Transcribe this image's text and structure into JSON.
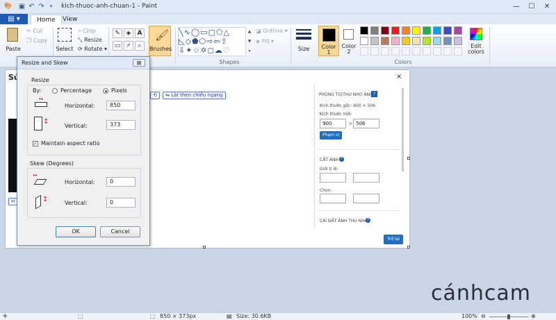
{
  "window": {
    "title": "kich-thuoc-anh-chuan-1 - Paint"
  },
  "tabs": {
    "file": "▤ ▾",
    "home": "Home",
    "view": "View"
  },
  "ribbon": {
    "clipboard": {
      "paste": "Paste",
      "cut": "Cut",
      "copy": "Copy",
      "label": "C"
    },
    "image": {
      "select": "Select",
      "crop": "Crop",
      "resize": "Resize",
      "rotate": "Rotate ▾"
    },
    "tools": {
      "brushes": "Brushes"
    },
    "shapes": {
      "outline": "Outline ▾",
      "fill": "Fill ▾",
      "label": "Shapes",
      "size": "Size"
    },
    "colors": {
      "color1": "Color 1",
      "color2": "Color 2",
      "edit": "Edit colors",
      "label": "Colors",
      "palette_row1": [
        "#000000",
        "#7f7f7f",
        "#880015",
        "#ed1c24",
        "#ff7f27",
        "#fff200",
        "#22b14c",
        "#00a2e8",
        "#3f48cc",
        "#a349a4"
      ],
      "palette_row2": [
        "#ffffff",
        "#c3c3c3",
        "#b97a57",
        "#ffaec9",
        "#ffc90e",
        "#efe4b0",
        "#b5e61d",
        "#99d9ea",
        "#7092be",
        "#c8bfe7"
      ]
    }
  },
  "webpanel": {
    "heading": "Sử",
    "flip_btn": "Lật theo chiều ngang",
    "close": "×",
    "side": {
      "section1_title": "PHONG TO/THU NHO ANH",
      "orig_size": "Kích thước gốc: 900 × 506",
      "new_size": "Kích thước mới:",
      "width": "900",
      "height": "506",
      "times": "×",
      "scale_btn": "Phạm vi",
      "section2_title": "CẮT ẢNH",
      "ratio": "Giới tỉ lệ:",
      "selection": "Chọn:",
      "section3_title": "CÀI ĐẶT ẢNH THU NHỎ"
    },
    "back_btn": "Trở lại",
    "left_btn": "H"
  },
  "dialog": {
    "title": "Resize and Skew",
    "close": "⊠",
    "resize_label": "Resize",
    "by": "By:",
    "percentage": "Percentage",
    "pixels": "Pixels",
    "horizontal": "Horizontal:",
    "vertical": "Vertical:",
    "h_value": "850",
    "v_value": "373",
    "aspect": "Maintain aspect ratio",
    "skew_label": "Skew (Degrees)",
    "skew_h_label": "Horizontal:",
    "skew_v_label": "Vertical:",
    "skew_h": "0",
    "skew_v": "0",
    "ok": "OK",
    "cancel": "Cancel"
  },
  "status": {
    "dims": "850 × 373px",
    "size": "Size: 30.6KB",
    "zoom": "100%"
  },
  "watermark": "cánhcam"
}
